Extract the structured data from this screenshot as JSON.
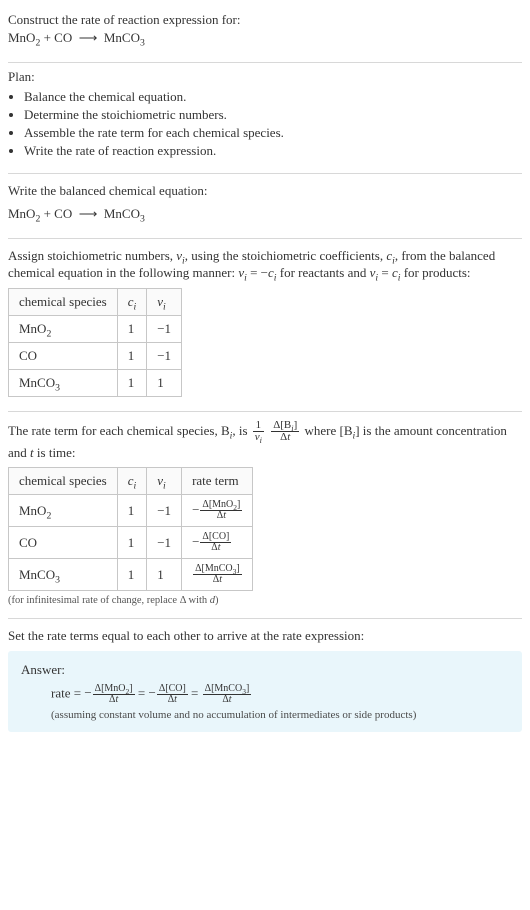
{
  "header": {
    "title": "Construct the rate of reaction expression for:",
    "equation_html": "MnO<sub>2</sub> + CO &nbsp;⟶&nbsp; MnCO<sub>3</sub>"
  },
  "plan": {
    "label": "Plan:",
    "items": [
      "Balance the chemical equation.",
      "Determine the stoichiometric numbers.",
      "Assemble the rate term for each chemical species.",
      "Write the rate of reaction expression."
    ]
  },
  "balanced": {
    "label": "Write the balanced chemical equation:",
    "equation_html": "MnO<sub>2</sub> + CO &nbsp;⟶&nbsp; MnCO<sub>3</sub>"
  },
  "assign": {
    "para_html": "Assign stoichiometric numbers, <span class='it'>ν<sub>i</sub></span>, using the stoichiometric coefficients, <span class='it'>c<sub>i</sub></span>, from the balanced chemical equation in the following manner: <span class='it'>ν<sub>i</sub></span> = −<span class='it'>c<sub>i</sub></span> for reactants and <span class='it'>ν<sub>i</sub></span> = <span class='it'>c<sub>i</sub></span> for products:",
    "table": {
      "headers": {
        "species": "chemical species",
        "ci_html": "<span class='it'>c<sub>i</sub></span>",
        "vi_html": "<span class='it'>ν<sub>i</sub></span>"
      },
      "rows": [
        {
          "species_html": "MnO<sub>2</sub>",
          "ci": "1",
          "vi": "−1"
        },
        {
          "species_html": "CO",
          "ci": "1",
          "vi": "−1"
        },
        {
          "species_html": "MnCO<sub>3</sub>",
          "ci": "1",
          "vi": "1"
        }
      ]
    }
  },
  "rateterm": {
    "intro_pre": "The rate term for each chemical species, B",
    "intro_mid": ", is ",
    "intro_post_html": " where [B<span class='sub it'>i</span>] is the amount concentration and <span class='it'>t</span> is time:",
    "frac1_num_html": "1",
    "frac1_den_html": "<span class='it'>ν</span><span class='sub it'>i</span>",
    "frac2_num_html": "Δ[B<span class='sub it'>i</span>]",
    "frac2_den_html": "Δ<span class='it'>t</span>",
    "table": {
      "headers": {
        "species": "chemical species",
        "ci_html": "<span class='it'>c<sub>i</sub></span>",
        "vi_html": "<span class='it'>ν<sub>i</sub></span>",
        "rate": "rate term"
      },
      "rows": [
        {
          "species_html": "MnO<sub>2</sub>",
          "ci": "1",
          "vi": "−1",
          "rate_num_html": "Δ[MnO<sub>2</sub>]",
          "rate_den_html": "Δ<span class='it'>t</span>",
          "neg": "−"
        },
        {
          "species_html": "CO",
          "ci": "1",
          "vi": "−1",
          "rate_num_html": "Δ[CO]",
          "rate_den_html": "Δ<span class='it'>t</span>",
          "neg": "−"
        },
        {
          "species_html": "MnCO<sub>3</sub>",
          "ci": "1",
          "vi": "1",
          "rate_num_html": "Δ[MnCO<sub>3</sub>]",
          "rate_den_html": "Δ<span class='it'>t</span>",
          "neg": ""
        }
      ]
    },
    "footnote_html": "(for infinitesimal rate of change, replace Δ with <span class='it'>d</span>)"
  },
  "setequal": {
    "text": "Set the rate terms equal to each other to arrive at the rate expression:"
  },
  "answer": {
    "label": "Answer:",
    "rate_label": "rate = ",
    "terms": [
      {
        "neg": "−",
        "num_html": "Δ[MnO<sub>2</sub>]",
        "den_html": "Δ<span class='it'>t</span>"
      },
      {
        "neg": "−",
        "num_html": "Δ[CO]",
        "den_html": "Δ<span class='it'>t</span>"
      },
      {
        "neg": "",
        "num_html": "Δ[MnCO<sub>3</sub>]",
        "den_html": "Δ<span class='it'>t</span>"
      }
    ],
    "eq": " = ",
    "note": "(assuming constant volume and no accumulation of intermediates or side products)"
  }
}
